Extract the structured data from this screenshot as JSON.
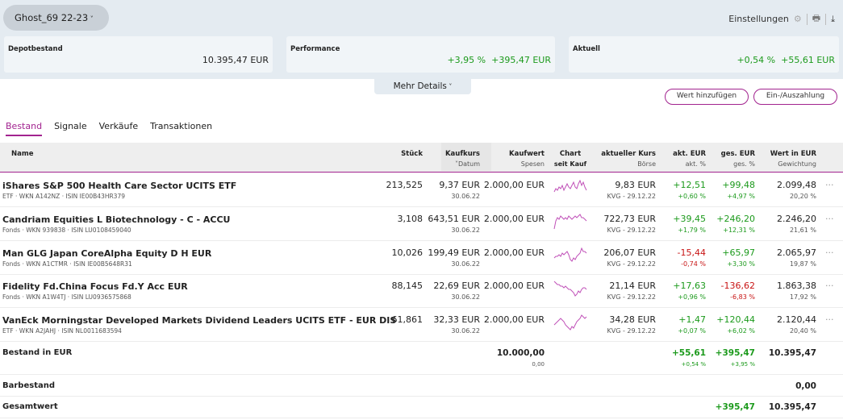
{
  "header": {
    "account": "Ghost_69 22-23",
    "settings": "Einstellungen"
  },
  "cards": [
    {
      "label": "Depotbestand",
      "value": "10.395,47 EUR"
    },
    {
      "label": "Performance",
      "pct": "+3,95 %",
      "value": "+395,47 EUR"
    },
    {
      "label": "Aktuell",
      "pct": "+0,54 %",
      "value": "+55,61 EUR"
    }
  ],
  "more_details": "Mehr Details",
  "buttons": {
    "add": "Wert hinzufügen",
    "cash": "Ein-/Auszahlung"
  },
  "tabs": [
    "Bestand",
    "Signale",
    "Verkäufe",
    "Transaktionen"
  ],
  "columns": {
    "name": "Name",
    "qty": "Stück",
    "buy": "Kaufkurs",
    "buy_sub": "Datum",
    "value": "Kaufwert",
    "value_sub": "Spesen",
    "chart": "Chart",
    "chart_sub": "seit Kauf",
    "price": "aktueller Kurs",
    "price_sub": "Börse",
    "akt": "akt. EUR",
    "akt_sub": "akt. %",
    "ges": "ges. EUR",
    "ges_sub": "ges. %",
    "worth": "Wert in EUR",
    "worth_sub": "Gewichtung"
  },
  "colors": {
    "accent": "#a2238f",
    "positive": "#1c9a1c",
    "negative": "#c81414"
  },
  "rows": [
    {
      "name": "iShares S&P 500 Health Care Sector UCITS ETF",
      "meta": "ETF · WKN A142NZ · ISIN IE00B43HR379",
      "qty": "213,525",
      "buy": "9,37 EUR",
      "date": "30.06.22",
      "value": "2.000,00 EUR",
      "price": "9,83 EUR",
      "exch": "KVG - 29.12.22",
      "akt": "+12,51",
      "akt_pct": "+0,60 %",
      "ges": "+99,48",
      "ges_pct": "+4,97 %",
      "worth": "2.099,48",
      "weight": "20,20 %",
      "spark": [
        3,
        5,
        4,
        6,
        5,
        7,
        4,
        6,
        8,
        6,
        5,
        7,
        9,
        6,
        5,
        8,
        10,
        7,
        9,
        6,
        4
      ]
    },
    {
      "name": "Candriam Equities L Biotechnology - C - ACCU",
      "meta": "Fonds · WKN 939838 · ISIN LU0108459040",
      "qty": "3,108",
      "buy": "643,51 EUR",
      "date": "30.06.22",
      "value": "2.000,00 EUR",
      "price": "722,73 EUR",
      "exch": "KVG - 29.12.22",
      "akt": "+39,45",
      "akt_pct": "+1,79 %",
      "ges": "+246,20",
      "ges_pct": "+12,31 %",
      "worth": "2.246,20",
      "weight": "21,61 %",
      "spark": [
        1,
        6,
        8,
        7,
        9,
        8,
        7,
        8,
        7,
        9,
        8,
        7,
        8,
        9,
        8,
        9,
        10,
        8,
        8,
        7,
        6
      ]
    },
    {
      "name": "Man GLG Japan CoreAlpha Equity D H EUR",
      "meta": "Fonds · WKN A1CTMR · ISIN IE00B5648R31",
      "qty": "10,026",
      "buy": "199,49 EUR",
      "date": "30.06.22",
      "value": "2.000,00 EUR",
      "price": "206,07 EUR",
      "exch": "KVG - 29.12.22",
      "akt": "-15,44",
      "akt_pct": "-0,74 %",
      "ges": "+65,97",
      "ges_pct": "+3,30 %",
      "worth": "2.065,97",
      "weight": "19,87 %",
      "spark": [
        4,
        5,
        5,
        6,
        5,
        7,
        6,
        7,
        8,
        6,
        3,
        2,
        4,
        3,
        5,
        6,
        7,
        10,
        8,
        8,
        7
      ]
    },
    {
      "name": "Fidelity Fd.China Focus Fd.Y Acc EUR",
      "meta": "Fonds · WKN A1W4TJ · ISIN LU0936575868",
      "qty": "88,145",
      "buy": "22,69 EUR",
      "date": "30.06.22",
      "value": "2.000,00 EUR",
      "price": "21,14 EUR",
      "exch": "KVG - 29.12.22",
      "akt": "+17,63",
      "akt_pct": "+0,96 %",
      "ges": "-136,62",
      "ges_pct": "-6,83 %",
      "worth": "1.863,38",
      "weight": "17,92 %",
      "spark": [
        10,
        9,
        8,
        8,
        7,
        7,
        6,
        7,
        6,
        5,
        5,
        4,
        3,
        1,
        2,
        4,
        3,
        5,
        6,
        6,
        5
      ]
    },
    {
      "name": "VanEck Morningstar Developed Markets Dividend Leaders UCITS ETF - EUR DIS",
      "meta": "ETF · WKN A2JAHJ · ISIN NL0011683594",
      "qty": "61,861",
      "buy": "32,33 EUR",
      "date": "30.06.22",
      "value": "2.000,00 EUR",
      "price": "34,28 EUR",
      "exch": "KVG - 29.12.22",
      "akt": "+1,47",
      "akt_pct": "+0,07 %",
      "ges": "+120,44",
      "ges_pct": "+6,02 %",
      "worth": "2.120,44",
      "weight": "20,40 %",
      "spark": [
        4,
        5,
        6,
        7,
        8,
        7,
        6,
        4,
        3,
        2,
        1,
        3,
        2,
        4,
        6,
        7,
        8,
        10,
        9,
        8,
        9
      ]
    }
  ],
  "total": {
    "label": "Bestand in EUR",
    "value": "10.000,00",
    "fees": "0,00",
    "akt": "+55,61",
    "akt_pct": "+0,54 %",
    "ges": "+395,47",
    "ges_pct": "+3,95 %",
    "worth": "10.395,47"
  },
  "cash": {
    "label": "Barbestand",
    "worth": "0,00"
  },
  "grand": {
    "label": "Gesamtwert",
    "ges": "+395,47",
    "worth": "10.395,47"
  }
}
